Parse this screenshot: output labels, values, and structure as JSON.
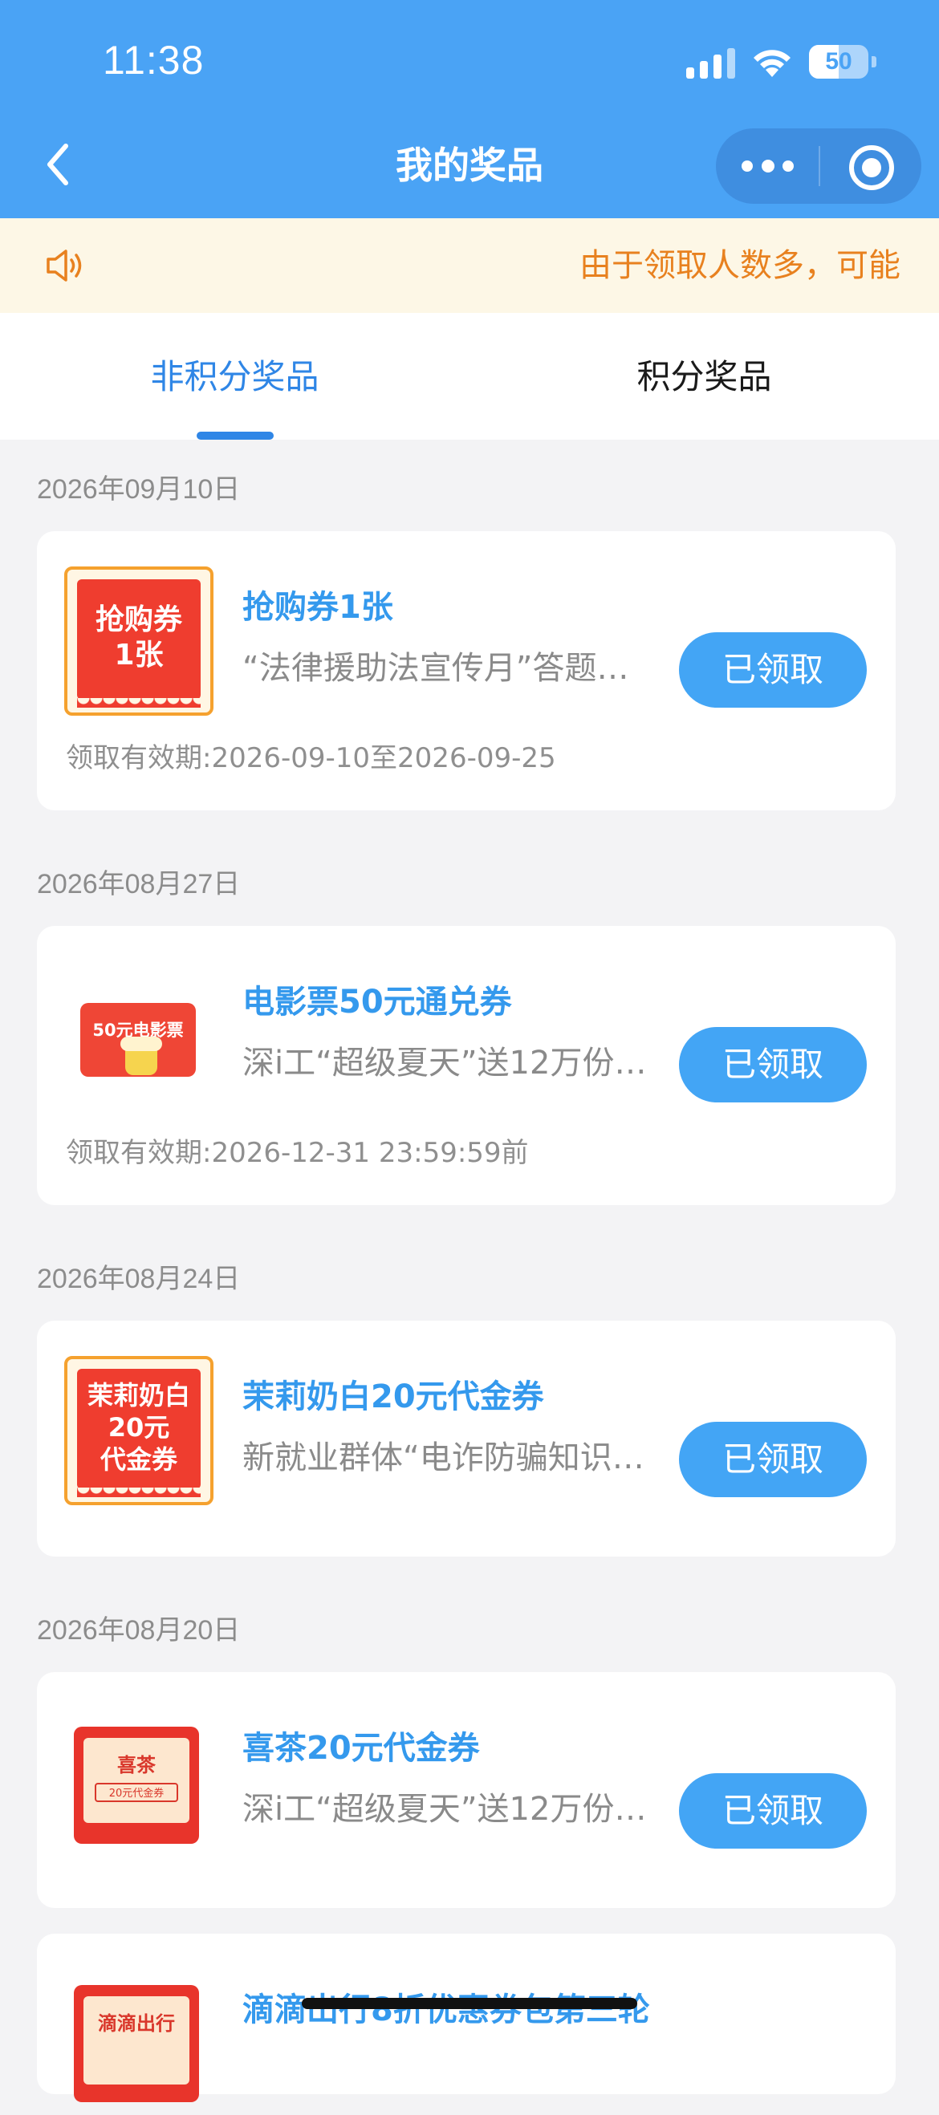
{
  "status_bar": {
    "time": "11:38",
    "battery": "50"
  },
  "navbar": {
    "title": "我的奖品"
  },
  "notice": {
    "text": "由于领取人数多，可能"
  },
  "tabs": [
    {
      "label": "非积分奖品"
    },
    {
      "label": "积分奖品"
    }
  ],
  "prizes": [
    {
      "date": "2026年09月10日",
      "thumb_text": "抢购券\n1张",
      "title": "抢购券1张",
      "description": "“法律援助法宣传月”答题…",
      "button": "已领取",
      "validity": "领取有效期:2026-09-10至2026-09-25"
    },
    {
      "date": "2026年08月27日",
      "thumb_text": "50元电影票",
      "title": "电影票50元通兑券",
      "description": "深i工“超级夏天”送12万份…",
      "button": "已领取",
      "validity": "领取有效期:2026-12-31 23:59:59前"
    },
    {
      "date": "2026年08月24日",
      "thumb_text": "茉莉奶白\n20元\n代金券",
      "title": "茉莉奶白20元代金券",
      "description": "新就业群体“电诈防骗知识…",
      "button": "已领取"
    },
    {
      "date": "2026年08月20日",
      "thumb_title": "喜茶",
      "thumb_tag": "20元代金券",
      "title": "喜茶20元代金券",
      "description": "深i工“超级夏天”送12万份…",
      "button": "已领取"
    },
    {
      "thumb_title": "滴滴出行",
      "title": "滴滴出行8折优惠券包第三轮"
    }
  ],
  "colors": {
    "primary": "#4aa3f5",
    "accent_blue": "#3499ed",
    "notice_orange": "#e8811f",
    "button_blue": "#43a5f5"
  }
}
